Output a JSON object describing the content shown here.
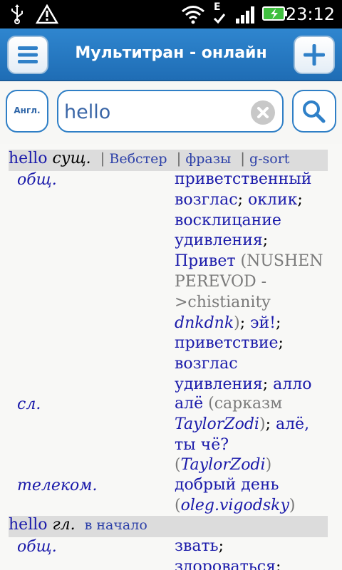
{
  "status_bar": {
    "clock": "23:12",
    "network_badge": "E",
    "icons": [
      "usb-icon",
      "warning-icon",
      "wifi-icon",
      "signal-icon",
      "battery-icon"
    ]
  },
  "header": {
    "title": "Мультитран - онлайн",
    "menu_icon": "hamburger-icon",
    "add_icon": "plus-icon"
  },
  "search": {
    "lang_button": "Англ.",
    "query": "hello",
    "clear_icon": "clear-icon",
    "search_icon": "magnifier-icon"
  },
  "entries": [
    {
      "word": "hello",
      "pos": "сущ.",
      "links": [
        "Вебстер",
        "фразы",
        "g-sort"
      ],
      "subjects": [
        {
          "subject": "общ.",
          "lines": [
            [
              {
                "t": "приветственный"
              }
            ],
            [
              {
                "t": "возглас"
              },
              {
                "t": "; ",
                "k": true
              },
              {
                "t": "оклик"
              },
              {
                "t": ";",
                "k": true
              }
            ],
            [
              {
                "t": "восклицание"
              }
            ],
            [
              {
                "t": "удивления"
              },
              {
                "t": ";",
                "k": true
              }
            ],
            [
              {
                "t": "Привет"
              },
              {
                "t": " (NUSHEN",
                "g": true
              }
            ],
            [
              {
                "t": "PEREVOD -",
                "g": true
              }
            ],
            [
              {
                "t": ">chistianity",
                "g": true
              }
            ],
            [
              {
                "t": "dnkdnk",
                "i": true
              },
              {
                "t": ")",
                "g": true
              },
              {
                "t": "; ",
                "k": true
              },
              {
                "t": "эй!"
              },
              {
                "t": ";",
                "k": true
              }
            ],
            [
              {
                "t": "приветствие"
              },
              {
                "t": ";",
                "k": true
              }
            ],
            [
              {
                "t": "возглас"
              }
            ],
            [
              {
                "t": "удивления"
              },
              {
                "t": "; ",
                "k": true
              },
              {
                "t": "алло"
              }
            ]
          ]
        },
        {
          "subject": "сл.",
          "lines": [
            [
              {
                "t": "алё"
              },
              {
                "t": " (сарказм",
                "g": true
              }
            ],
            [
              {
                "t": "TaylorZodi",
                "i": true
              },
              {
                "t": ")",
                "g": true
              },
              {
                "t": "; ",
                "k": true
              },
              {
                "t": "алё,"
              }
            ],
            [
              {
                "t": "ты чё?"
              }
            ],
            [
              {
                "t": "(",
                "g": true
              },
              {
                "t": "TaylorZodi",
                "i": true
              },
              {
                "t": ")",
                "g": true
              }
            ]
          ]
        },
        {
          "subject": "телеком.",
          "lines": [
            [
              {
                "t": "добрый день"
              }
            ],
            [
              {
                "t": "(",
                "g": true
              },
              {
                "t": "oleg.vigodsky",
                "i": true
              },
              {
                "t": ")",
                "g": true
              }
            ]
          ]
        }
      ]
    },
    {
      "word": "hello",
      "pos": "гл.",
      "link": "в начало",
      "subjects": [
        {
          "subject": "общ.",
          "lines": [
            [
              {
                "t": "звать"
              },
              {
                "t": ";",
                "k": true
              }
            ],
            [
              {
                "t": "здороваться"
              },
              {
                "t": ";",
                "k": true
              }
            ]
          ]
        }
      ]
    }
  ],
  "colors": {
    "header_blue": "#2f86cf",
    "link_blue": "#1a1aaa",
    "gray_note": "#7a7a7a"
  }
}
